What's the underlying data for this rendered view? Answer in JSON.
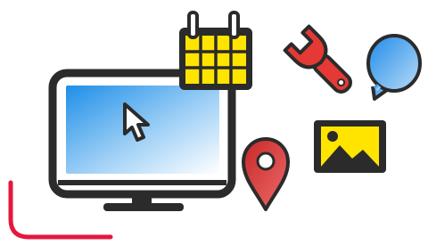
{
  "illustration": {
    "icons": [
      {
        "name": "computer-monitor-icon",
        "screen_gradient": [
          "#1e8fe8",
          "#ffffff"
        ]
      },
      {
        "name": "mouse-cursor-icon"
      },
      {
        "name": "calendar-icon",
        "fill": "#ffe400"
      },
      {
        "name": "wrench-icon",
        "fill": "#e53935"
      },
      {
        "name": "speech-bubble-icon",
        "fill": "#43a3f1"
      },
      {
        "name": "image-picture-icon",
        "fill": "#ffe400"
      },
      {
        "name": "location-pin-icon",
        "fill": "#e53935"
      }
    ],
    "colors": {
      "outline": "#2b2b2b",
      "red_accent": "#e5173d",
      "yellow": "#ffe400",
      "blue": "#1e8fe8"
    }
  }
}
